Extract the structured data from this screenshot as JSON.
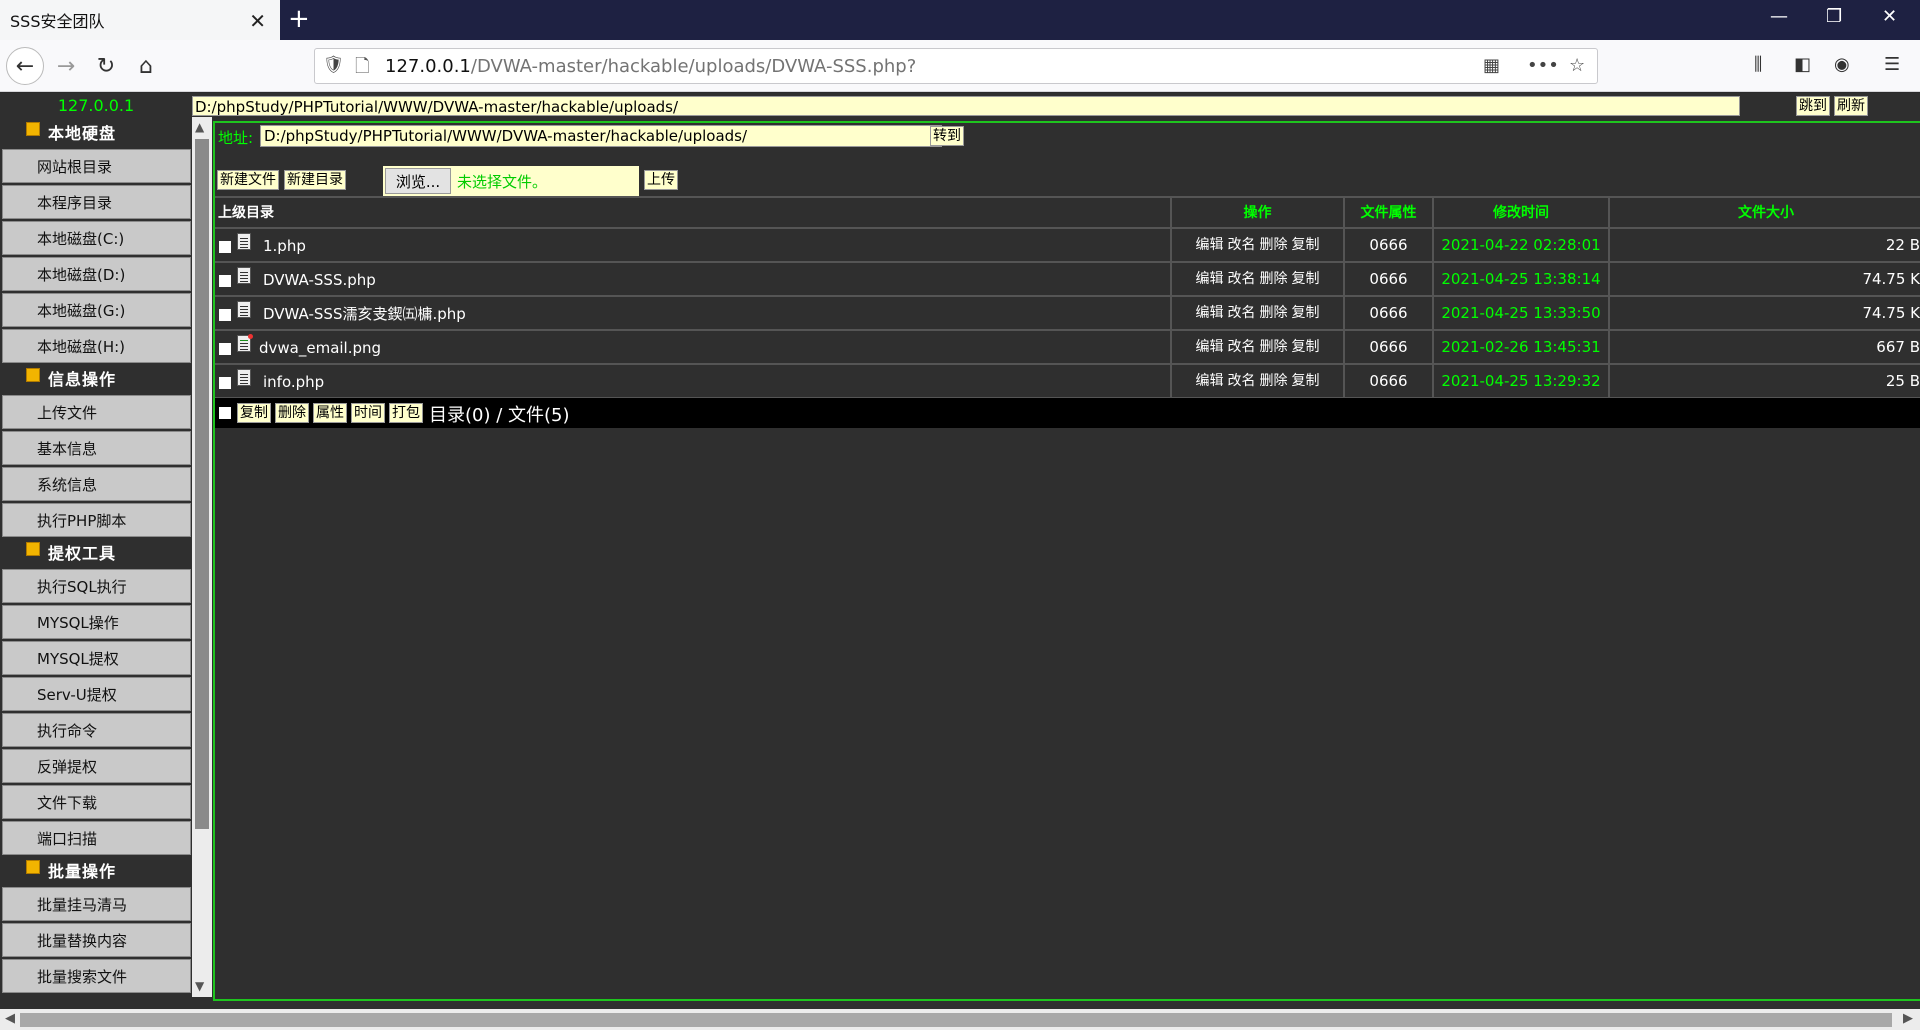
{
  "browser": {
    "tab_title": "SSS安全团队",
    "url_host": "127.0.0.1",
    "url_path": "/DVWA-master/hackable/uploads/DVWA-SSS.php?"
  },
  "top": {
    "host": "127.0.0.1",
    "path": "D:/phpStudy/PHPTutorial/WWW/DVWA-master/hackable/uploads/",
    "jump_label": "跳到",
    "refresh_label": "刷新"
  },
  "sidebar": {
    "sections": [
      {
        "title": "本地硬盘",
        "items": [
          "网站根目录",
          "本程序目录",
          "本地磁盘(C:)",
          "本地磁盘(D:)",
          "本地磁盘(G:)",
          "本地磁盘(H:)"
        ]
      },
      {
        "title": "信息操作",
        "items": [
          "上传文件",
          "基本信息",
          "系统信息",
          "执行PHP脚本"
        ]
      },
      {
        "title": "提权工具",
        "items": [
          "执行SQL执行",
          "MYSQL操作",
          "MYSQL提权",
          "Serv-U提权",
          "执行命令",
          "反弹提权",
          "文件下载",
          "端口扫描"
        ]
      },
      {
        "title": "批量操作",
        "items": [
          "批量挂马清马",
          "批量替换内容",
          "批量搜索文件"
        ]
      }
    ]
  },
  "main": {
    "addr_label": "地址:",
    "addr_value": "D:/phpStudy/PHPTutorial/WWW/DVWA-master/hackable/uploads/",
    "goto_label": "转到",
    "new_file_label": "新建文件",
    "new_dir_label": "新建目录",
    "browse_label": "浏览...",
    "no_file_label": "未选择文件。",
    "upload_label": "上传",
    "columns": {
      "parent": "上级目录",
      "ops": "操作",
      "attr": "文件属性",
      "mtime": "修改时间",
      "size": "文件大小"
    },
    "op_labels": {
      "edit": "编辑",
      "rename": "改名",
      "delete": "删除",
      "copy": "复制"
    },
    "files": [
      {
        "name": "1.php",
        "icon": "file-icon",
        "attr": "0666",
        "mtime": "2021-04-22 02:28:01",
        "size": "22 B"
      },
      {
        "name": "DVWA-SSS.php",
        "icon": "file-icon",
        "attr": "0666",
        "mtime": "2021-04-25 13:38:14",
        "size": "74.75 K"
      },
      {
        "name": "DVWA-SSS濡亥叏鍥㈤槦.php",
        "icon": "file-icon",
        "attr": "0666",
        "mtime": "2021-04-25 13:33:50",
        "size": "74.75 K"
      },
      {
        "name": "dvwa_email.png",
        "icon": "image-file-icon",
        "attr": "0666",
        "mtime": "2021-02-26 13:45:31",
        "size": "667 B"
      },
      {
        "name": "info.php",
        "icon": "file-icon",
        "attr": "0666",
        "mtime": "2021-04-25 13:29:32",
        "size": "25 B"
      }
    ],
    "actions": {
      "copy": "复制",
      "delete": "删除",
      "attr": "属性",
      "time": "时间",
      "pack": "打包"
    },
    "summary": "目录(0) / 文件(5)"
  }
}
